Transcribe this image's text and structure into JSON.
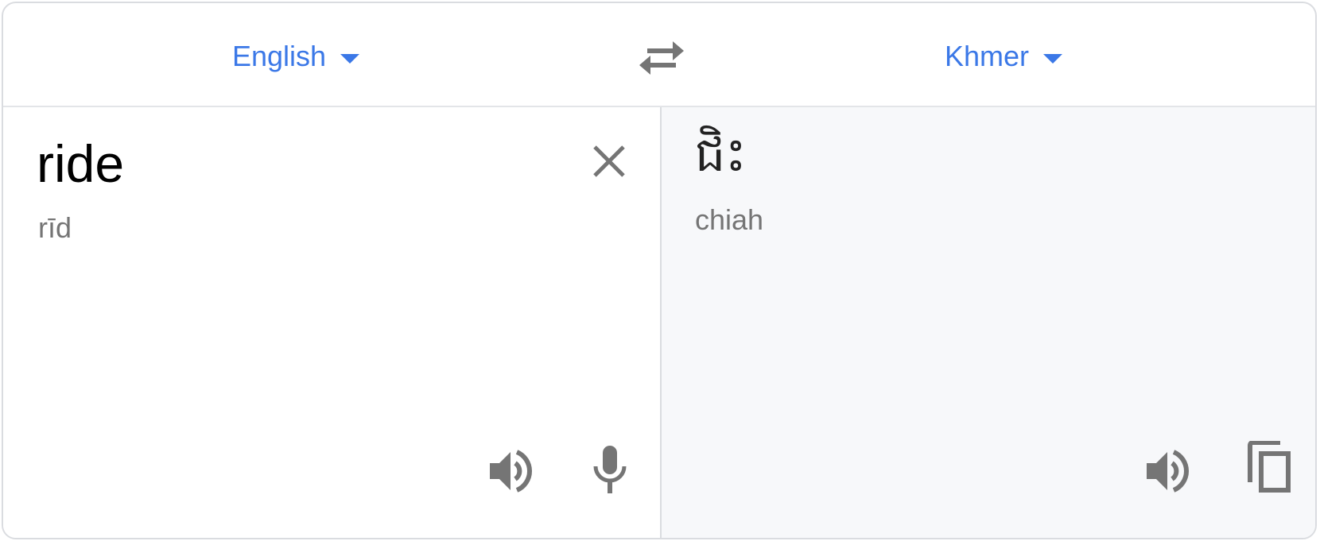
{
  "header": {
    "source_language": "English",
    "target_language": "Khmer"
  },
  "source": {
    "text": "ride",
    "transliteration": "rīd"
  },
  "target": {
    "text": "ជិះ",
    "transliteration": "chiah"
  },
  "icons": {
    "swap": "swap-languages-icon",
    "clear": "close-icon",
    "source_speak": "speaker-icon",
    "microphone": "microphone-icon",
    "target_speak": "speaker-icon",
    "copy": "copy-icon"
  },
  "colors": {
    "accent": "#3b78e7",
    "icon": "#757575",
    "target_background": "#f7f8fa",
    "border": "#dadce0"
  }
}
